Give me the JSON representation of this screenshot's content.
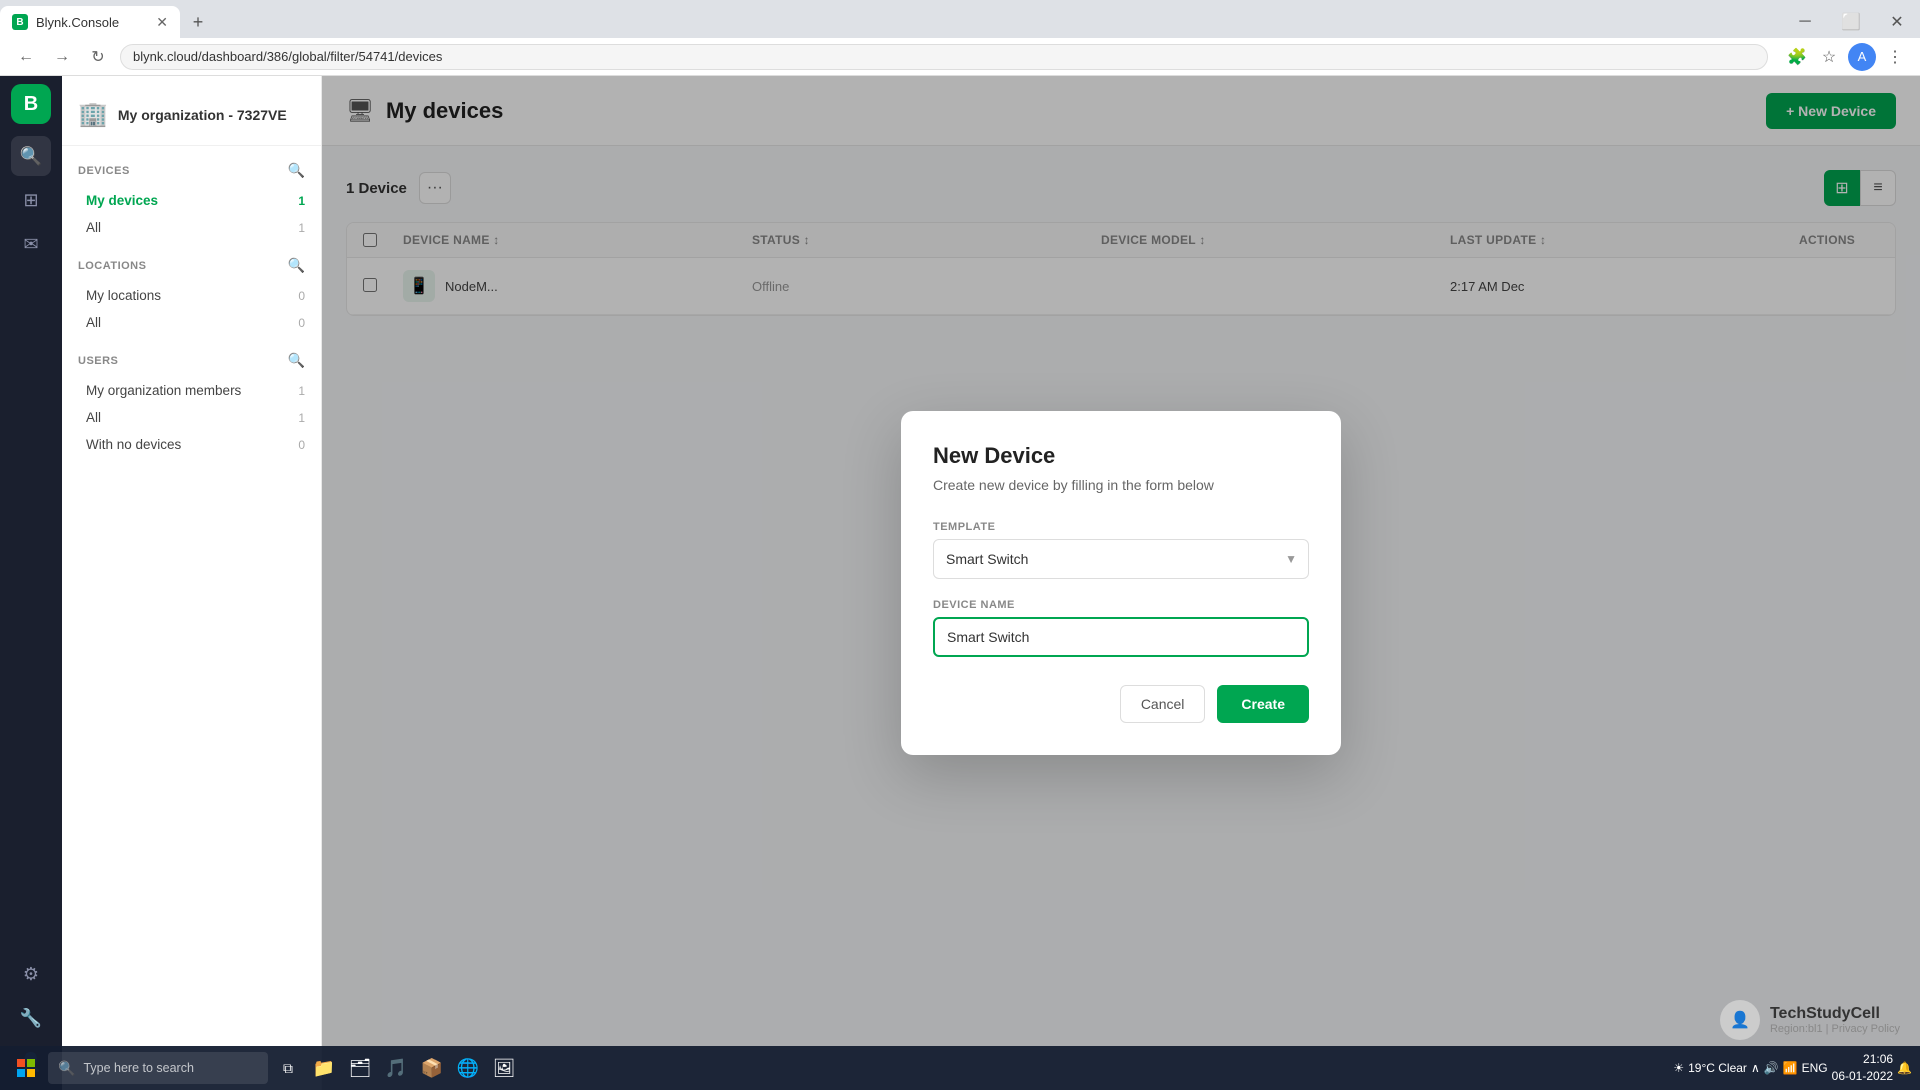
{
  "browser": {
    "tab_label": "Blynk.Console",
    "url": "blynk.cloud/dashboard/386/global/filter/54741/devices",
    "new_tab_label": "+"
  },
  "sidebar": {
    "logo_letter": "B",
    "org_name": "My organization - 7327VE",
    "sections": {
      "devices": {
        "label": "DEVICES",
        "items": [
          {
            "label": "My devices",
            "count": "1",
            "active": true
          },
          {
            "label": "All",
            "count": "1",
            "active": false
          }
        ]
      },
      "locations": {
        "label": "LOCATIONS",
        "items": [
          {
            "label": "My locations",
            "count": "0",
            "active": false
          },
          {
            "label": "All",
            "count": "0",
            "active": false
          }
        ]
      },
      "users": {
        "label": "USERS",
        "items": [
          {
            "label": "My organization members",
            "count": "1",
            "active": false
          },
          {
            "label": "All",
            "count": "1",
            "active": false
          },
          {
            "label": "With no devices",
            "count": "0",
            "active": false
          }
        ]
      }
    }
  },
  "main": {
    "page_title": "My devices",
    "new_device_btn": "+ New Device",
    "device_count": "1 Device",
    "table": {
      "columns": [
        "Device name",
        "Status",
        "Device model",
        "Last update",
        "Actions"
      ],
      "rows": [
        {
          "name": "NodeM...",
          "status": "Offline",
          "model": "",
          "last_update": "2:17 AM Dec",
          "actions": ""
        }
      ]
    }
  },
  "modal": {
    "title": "New Device",
    "subtitle": "Create new device by filling in the form below",
    "template_label": "TEMPLATE",
    "template_value": "Smart Switch",
    "device_name_label": "DEVICE NAME",
    "device_name_value": "Smart Switch",
    "cancel_btn": "Cancel",
    "create_btn": "Create"
  },
  "taskbar": {
    "search_placeholder": "Type here to search",
    "time": "21:06",
    "date": "06-01-2022",
    "temp": "19°C  Clear",
    "language": "ENG"
  },
  "watermark": {
    "channel": "TechStudyCell",
    "region": "Region:bl1 | Privacy Policy"
  }
}
